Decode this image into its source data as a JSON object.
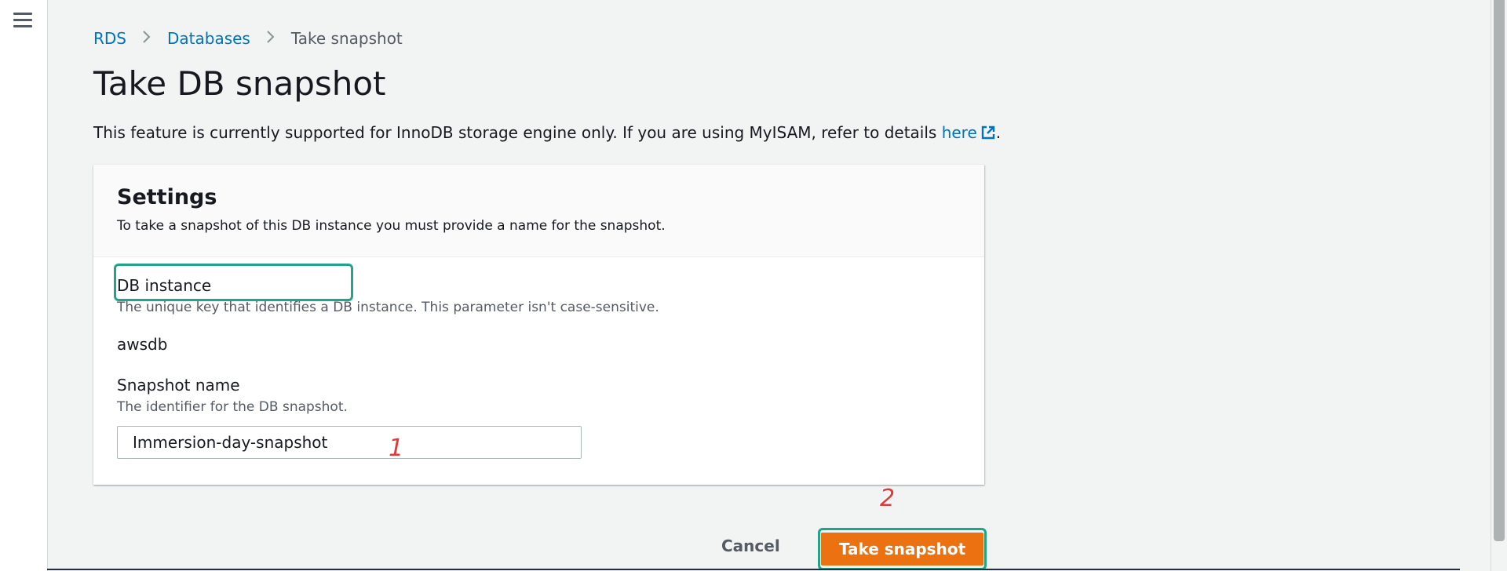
{
  "nav": {
    "menu_icon": "hamburger-menu-icon"
  },
  "breadcrumb": {
    "items": [
      "RDS",
      "Databases"
    ],
    "current": "Take snapshot",
    "separator_icon": "chevron-right-icon"
  },
  "page": {
    "title": "Take DB snapshot",
    "notice_text": "This feature is currently supported for InnoDB storage engine only. If you are using MyISAM, refer to details ",
    "notice_link": "here",
    "notice_end": ".",
    "notice_link_icon": "external-link-icon"
  },
  "settings": {
    "title": "Settings",
    "description": "To take a snapshot of this DB instance you must provide a name for the snapshot.",
    "db_instance": {
      "label": "DB instance",
      "description": "The unique key that identifies a DB instance. This parameter isn't case-sensitive.",
      "value": "awsdb"
    },
    "snapshot_name": {
      "label": "Snapshot name",
      "description": "The identifier for the DB snapshot.",
      "value": "Immersion-day-snapshot"
    }
  },
  "annotations": {
    "step1": "1",
    "step2": "2",
    "highlight_color": "#1fa58b",
    "step_color": "#e03a3a"
  },
  "actions": {
    "cancel_label": "Cancel",
    "submit_label": "Take snapshot"
  },
  "colors": {
    "link": "#0073bb",
    "primary_button": "#ec7211",
    "background": "#f2f3f3"
  }
}
